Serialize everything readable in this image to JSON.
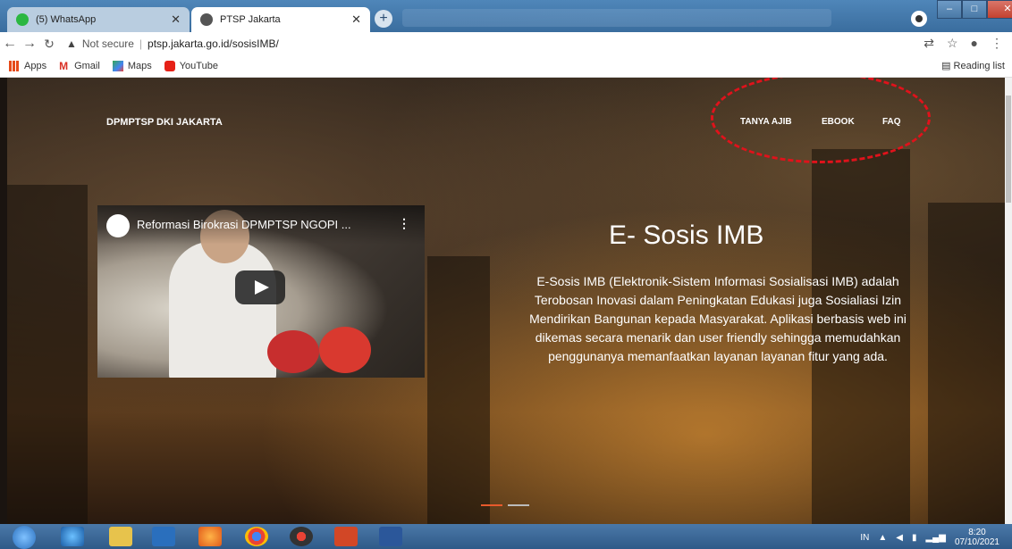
{
  "browser": {
    "tabs": [
      {
        "label": "(5) WhatsApp",
        "active": false
      },
      {
        "label": "PTSP Jakarta",
        "active": true
      }
    ],
    "new_tab_label": "+",
    "security_label": "Not secure",
    "url": "ptsp.jakarta.go.id/sosisIMB/",
    "bookmarks": [
      "Apps",
      "Gmail",
      "Maps",
      "YouTube"
    ],
    "reading_list": "Reading list"
  },
  "site": {
    "brand": "DPMPTSP DKI JAKARTA",
    "nav": [
      "TANYA AJIB",
      "EBOOK",
      "FAQ"
    ],
    "video_title": "Reformasi Birokrasi DPMPTSP NGOPI ...",
    "hero_title": "E- Sosis IMB",
    "hero_text": "E-Sosis IMB (Elektronik-Sistem Informasi Sosialisasi IMB) adalah Terobosan Inovasi dalam Peningkatan Edukasi juga Sosialiasi Izin Mendirikan Bangunan kepada Masyarakat. Aplikasi berbasis web ini dikemas secara menarik dan user friendly sehingga memudahkan penggunanya memanfaatkan layanan layanan fitur yang ada."
  },
  "taskbar": {
    "lang": "IN",
    "time": "8:20",
    "date": "07/10/2021"
  },
  "colors": {
    "annotation_ellipse": "#e0121b",
    "titlebar": "#4f86b9"
  }
}
